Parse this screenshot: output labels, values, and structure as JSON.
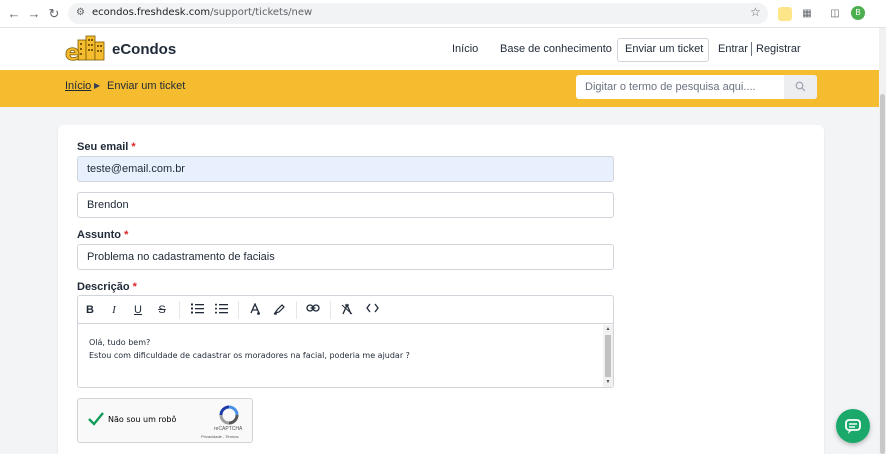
{
  "browser": {
    "url_host": "econdos.freshdesk.com",
    "url_path": "/support/tickets/new",
    "profile_initial": "B"
  },
  "header": {
    "brand": "eCondos",
    "nav": [
      "Início",
      "Base de conhecimento",
      "Enviar um ticket",
      "Entrar",
      "Registrar"
    ]
  },
  "breadcrumb": {
    "home": "Início",
    "current": "Enviar um ticket"
  },
  "search": {
    "placeholder": "Digitar o termo de pesquisa aqui...."
  },
  "form": {
    "email_label": "Seu email",
    "email_value": "teste@email.com.br",
    "name_value": "Brendon",
    "subject_label": "Assunto",
    "subject_value": "Problema no cadastramento de faciais",
    "description_label": "Descrição",
    "description_lines": [
      "Olá, tudo bem?",
      "Estou com dificuldade de cadastrar os moradores na facial, poderia me ajudar ?"
    ],
    "required_marker": "*"
  },
  "toolbar": {
    "bold": "B",
    "italic": "I",
    "underline": "U",
    "strike": "S"
  },
  "captcha": {
    "label": "Não sou um robô",
    "brand": "reCAPTCHA",
    "links": "Privacidade - Termos"
  },
  "colors": {
    "accent_yellow": "#f5bc30",
    "chat_green": "#1aa96b",
    "required_red": "#dc2626"
  }
}
